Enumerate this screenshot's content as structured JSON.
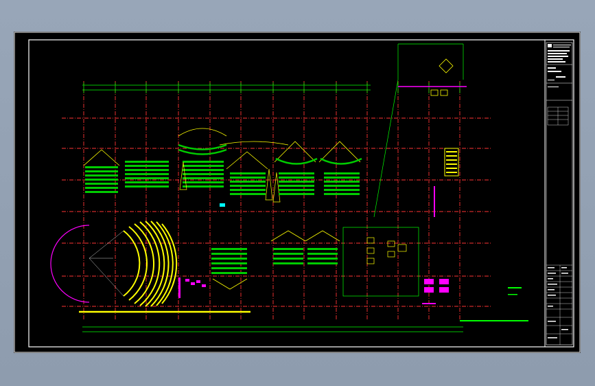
{
  "drawing": {
    "background": "#000000",
    "frame_color": "#ffffff",
    "axis_grid_color": "#ff3333",
    "dimension_line_color": "#00ff00",
    "accent_colors": {
      "seats": "#00cc00",
      "roof": "#ffff00",
      "magenta": "#ff00ff",
      "cyan": "#00ffff"
    }
  },
  "title_block": {
    "header": "",
    "revision_rows": 12,
    "sheet_label": ""
  },
  "legend": {
    "bottom_note": ""
  }
}
